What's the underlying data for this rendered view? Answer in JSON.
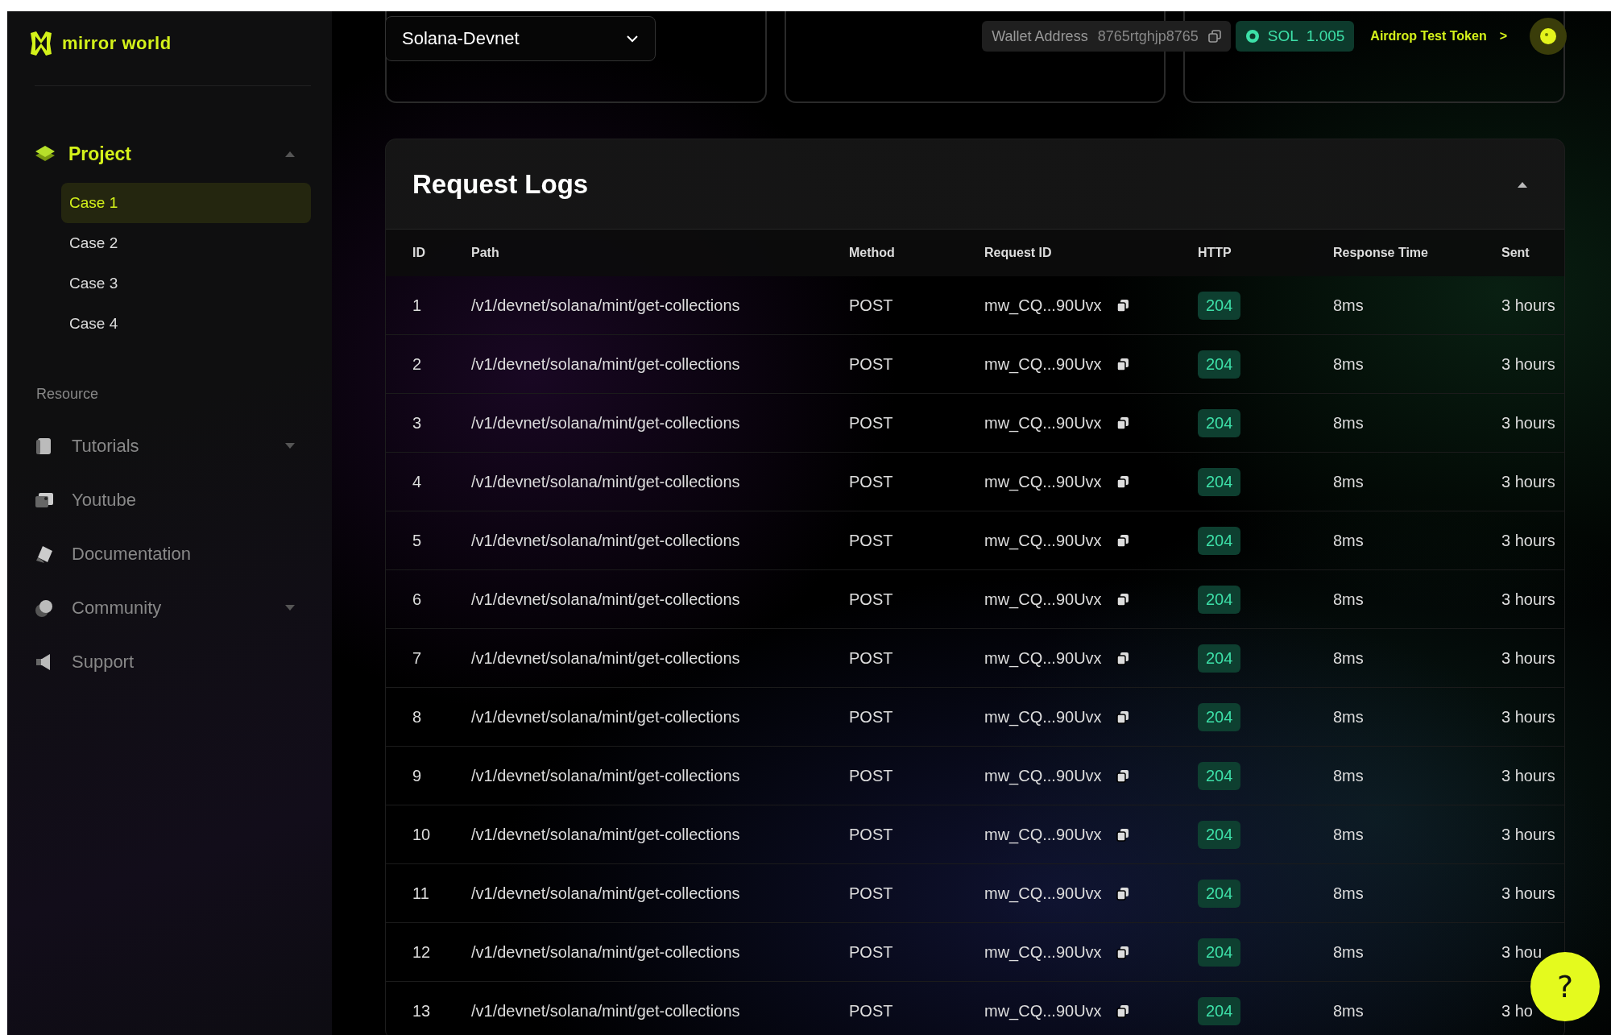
{
  "sidebar": {
    "logo": "mirror world",
    "project": {
      "label": "Project",
      "expanded": true,
      "children": [
        {
          "label": "Case 1",
          "selected": true
        },
        {
          "label": "Case 2",
          "selected": false
        },
        {
          "label": "Case 3",
          "selected": false
        },
        {
          "label": "Case 4",
          "selected": false
        }
      ]
    },
    "resource_heading": "Resource",
    "resource_items": [
      {
        "label": "Tutorials",
        "kind": "collapsible",
        "expanded": false
      },
      {
        "label": "Youtube",
        "kind": "link"
      },
      {
        "label": "Documentation",
        "kind": "link"
      },
      {
        "label": "Community",
        "kind": "collapsible",
        "expanded": false
      },
      {
        "label": "Support",
        "kind": "link"
      }
    ]
  },
  "topbar": {
    "network_select": {
      "value": "Solana-Devnet"
    },
    "wallet": {
      "label": "Wallet Address",
      "address": "8765rtghjp8765"
    },
    "balance": {
      "currency": "SOL",
      "amount": "1.005"
    },
    "airdrop_link": {
      "label": "Airdrop Test Token",
      "arrow": ">"
    }
  },
  "request_logs": {
    "title": "Request Logs",
    "expanded": true,
    "columns": [
      "ID",
      "Path",
      "Method",
      "Request ID",
      "HTTP",
      "Response Time",
      "Sent"
    ],
    "rows": [
      {
        "id": "1",
        "path": "/v1/devnet/solana/mint/get-collections",
        "method": "POST",
        "request_id": "mw_CQ...90Uvx",
        "http": "204",
        "response_time": "8ms",
        "sent": "3 hours"
      },
      {
        "id": "2",
        "path": "/v1/devnet/solana/mint/get-collections",
        "method": "POST",
        "request_id": "mw_CQ...90Uvx",
        "http": "204",
        "response_time": "8ms",
        "sent": "3 hours"
      },
      {
        "id": "3",
        "path": "/v1/devnet/solana/mint/get-collections",
        "method": "POST",
        "request_id": "mw_CQ...90Uvx",
        "http": "204",
        "response_time": "8ms",
        "sent": "3 hours"
      },
      {
        "id": "4",
        "path": "/v1/devnet/solana/mint/get-collections",
        "method": "POST",
        "request_id": "mw_CQ...90Uvx",
        "http": "204",
        "response_time": "8ms",
        "sent": "3 hours"
      },
      {
        "id": "5",
        "path": "/v1/devnet/solana/mint/get-collections",
        "method": "POST",
        "request_id": "mw_CQ...90Uvx",
        "http": "204",
        "response_time": "8ms",
        "sent": "3 hours"
      },
      {
        "id": "6",
        "path": "/v1/devnet/solana/mint/get-collections",
        "method": "POST",
        "request_id": "mw_CQ...90Uvx",
        "http": "204",
        "response_time": "8ms",
        "sent": "3 hours"
      },
      {
        "id": "7",
        "path": "/v1/devnet/solana/mint/get-collections",
        "method": "POST",
        "request_id": "mw_CQ...90Uvx",
        "http": "204",
        "response_time": "8ms",
        "sent": "3 hours"
      },
      {
        "id": "8",
        "path": "/v1/devnet/solana/mint/get-collections",
        "method": "POST",
        "request_id": "mw_CQ...90Uvx",
        "http": "204",
        "response_time": "8ms",
        "sent": "3 hours"
      },
      {
        "id": "9",
        "path": "/v1/devnet/solana/mint/get-collections",
        "method": "POST",
        "request_id": "mw_CQ...90Uvx",
        "http": "204",
        "response_time": "8ms",
        "sent": "3 hours"
      },
      {
        "id": "10",
        "path": "/v1/devnet/solana/mint/get-collections",
        "method": "POST",
        "request_id": "mw_CQ...90Uvx",
        "http": "204",
        "response_time": "8ms",
        "sent": "3 hours"
      },
      {
        "id": "11",
        "path": "/v1/devnet/solana/mint/get-collections",
        "method": "POST",
        "request_id": "mw_CQ...90Uvx",
        "http": "204",
        "response_time": "8ms",
        "sent": "3 hours"
      },
      {
        "id": "12",
        "path": "/v1/devnet/solana/mint/get-collections",
        "method": "POST",
        "request_id": "mw_CQ...90Uvx",
        "http": "204",
        "response_time": "8ms",
        "sent": "3 hou"
      },
      {
        "id": "13",
        "path": "/v1/devnet/solana/mint/get-collections",
        "method": "POST",
        "request_id": "mw_CQ...90Uvx",
        "http": "204",
        "response_time": "8ms",
        "sent": "3 ho"
      }
    ]
  },
  "help_button": {
    "label": "?"
  }
}
